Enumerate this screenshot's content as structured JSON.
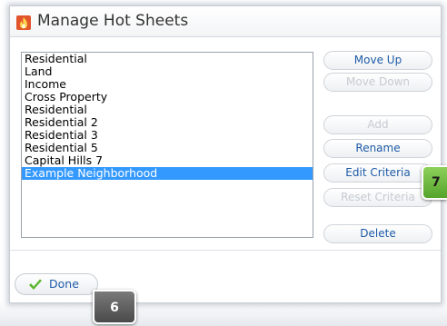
{
  "dialog": {
    "title": "Manage Hot Sheets",
    "title_icon": "flame-icon"
  },
  "list": {
    "items": [
      "Residential",
      "Land",
      "Income",
      "Cross Property",
      "Residential",
      "Residential 2",
      "Residential 3",
      "Residential 5",
      "Capital Hills 7",
      "Example Neighborhood"
    ],
    "selected_index": 9
  },
  "buttons": {
    "move_up": "Move Up",
    "move_down": "Move Down",
    "add": "Add",
    "rename": "Rename",
    "edit_criteria": "Edit Criteria",
    "reset_criteria": "Reset Criteria",
    "delete": "Delete",
    "done": "Done"
  },
  "callouts": {
    "done": "6",
    "edit_criteria": "7"
  },
  "colors": {
    "selection": "#3399ff",
    "button_text": "#1e5ba8",
    "disabled_text": "#c6cbd1",
    "check": "#5cb82e",
    "callout_gray": "#5a5a5a",
    "callout_green": "#6dbb3a"
  }
}
